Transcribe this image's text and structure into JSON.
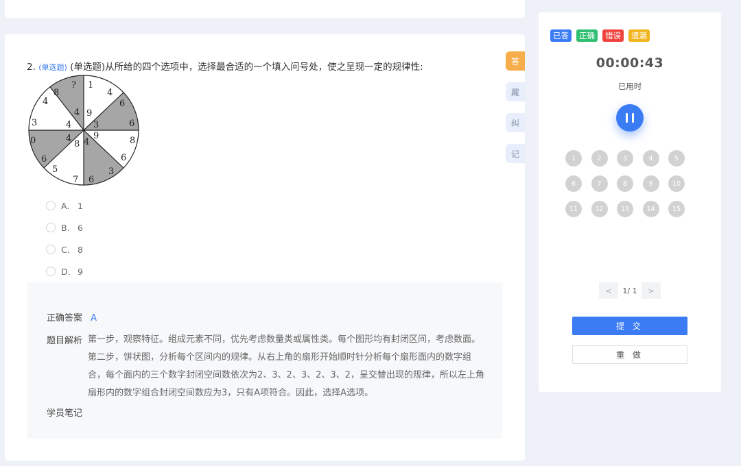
{
  "question": {
    "number": "2.",
    "type_tag": "(单选题)",
    "text": "(单选题)从所给的四个选项中，选择最合适的一个填入问号处，使之呈现一定的规律性:",
    "figure_numbers": [
      "?",
      "8",
      "4",
      "4",
      "3",
      "4",
      "0",
      "4",
      "6",
      "5",
      "8",
      "7",
      "6",
      "4",
      "9",
      "3",
      "6",
      "8",
      "6",
      "3",
      "1",
      "4",
      "6",
      "9"
    ],
    "options": [
      {
        "letter": "A.",
        "value": "1"
      },
      {
        "letter": "B.",
        "value": "6"
      },
      {
        "letter": "C.",
        "value": "8"
      },
      {
        "letter": "D.",
        "value": "9"
      }
    ]
  },
  "analysis": {
    "answer_label": "正确答案",
    "answer_value": "A",
    "explain_label": "题目解析",
    "explain_text": "第一步，观察特征。组成元素不同，优先考虑数量类或属性类。每个图形均有封闭区间，考虑数面。第二步，饼状图，分析每个区间内的规律。从右上角的扇形开始顺时针分析每个扇形面内的数字组合，每个面内的三个数字封闭空间数依次为2、3、2、3、2、3、2，呈交替出现的规律，所以左上角扇形内的数字组合封闭空间数应为3，只有A项符合。因此，选择A选项。",
    "notes_label": "学员笔记"
  },
  "side_tabs": [
    "答",
    "藏",
    "纠",
    "记"
  ],
  "panel": {
    "legend": [
      {
        "label": "已答",
        "color": "#3b7cf5"
      },
      {
        "label": "正确",
        "color": "#2fbf71"
      },
      {
        "label": "错误",
        "color": "#f0413c"
      },
      {
        "label": "遗漏",
        "color": "#f1b41c"
      }
    ],
    "timer": "00:00:43",
    "timer_label": "已用时",
    "numbers": [
      "1",
      "2",
      "3",
      "4",
      "5",
      "6",
      "7",
      "8",
      "9",
      "10",
      "11",
      "12",
      "13",
      "14",
      "15"
    ],
    "pager": {
      "prev": "<",
      "text": "1/ 1",
      "next": ">"
    },
    "submit_label": "提 交",
    "redo_label": "重 做"
  },
  "colors": {
    "accent": "#3b7cf5",
    "active_tab": "#f6ad4a",
    "pie_gray": "#a6a6a6"
  }
}
